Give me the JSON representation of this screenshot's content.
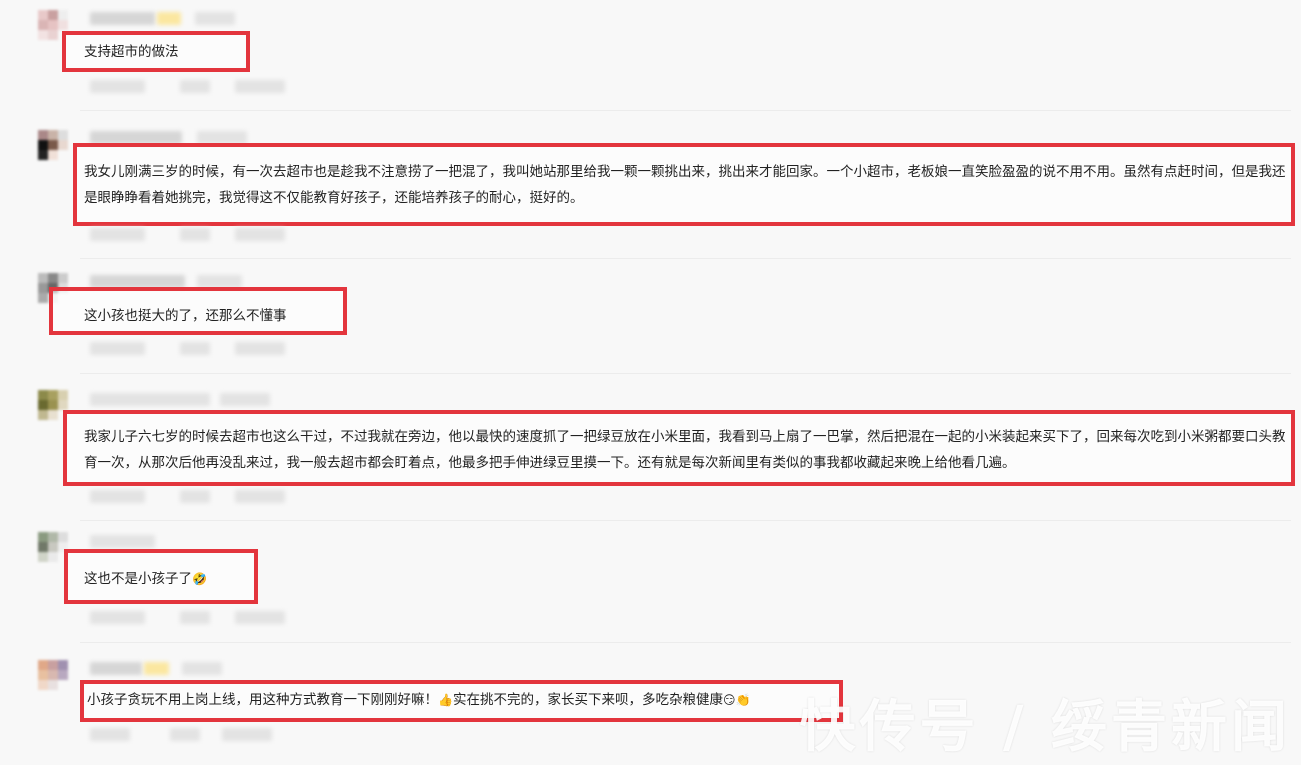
{
  "comments": [
    {
      "text": "支持超市的做法"
    },
    {
      "text": "我女儿刚满三岁的时候，有一次去超市也是趁我不注意捞了一把混了，我叫她站那里给我一颗一颗挑出来，挑出来才能回家。一个小超市，老板娘一直笑脸盈盈的说不用不用。虽然有点赶时间，但是我还是眼睁睁看着她挑完，我觉得这不仅能教育好孩子，还能培养孩子的耐心，挺好的。"
    },
    {
      "text": "这小孩也挺大的了，还那么不懂事"
    },
    {
      "text": "我家儿子六七岁的时候去超市也这么干过，不过我就在旁边，他以最快的速度抓了一把绿豆放在小米里面，我看到马上扇了一巴掌，然后把混在一起的小米装起来买下了，回来每次吃到小米粥都要口头教育一次，从那次后他再没乱来过，我一般去超市都会盯着点，他最多把手伸进绿豆里摸一下。还有就是每次新闻里有类似的事我都收藏起来晚上给他看几遍。"
    },
    {
      "text": "这也不是小孩子了",
      "emoji": "🤣"
    },
    {
      "text_a": "小孩子贪玩不用上岗上线，用这种方式教育一下刚刚好嘛！",
      "emoji_a": "👍",
      "text_b": "实在挑不完的，家长买下来呗，多吃杂粮健康",
      "emoji_b": "😏👏"
    }
  ],
  "watermark": "快传号 / 绥青新闻",
  "colors": {
    "highlight": "#e3353d",
    "background": "#f8f8f8"
  }
}
